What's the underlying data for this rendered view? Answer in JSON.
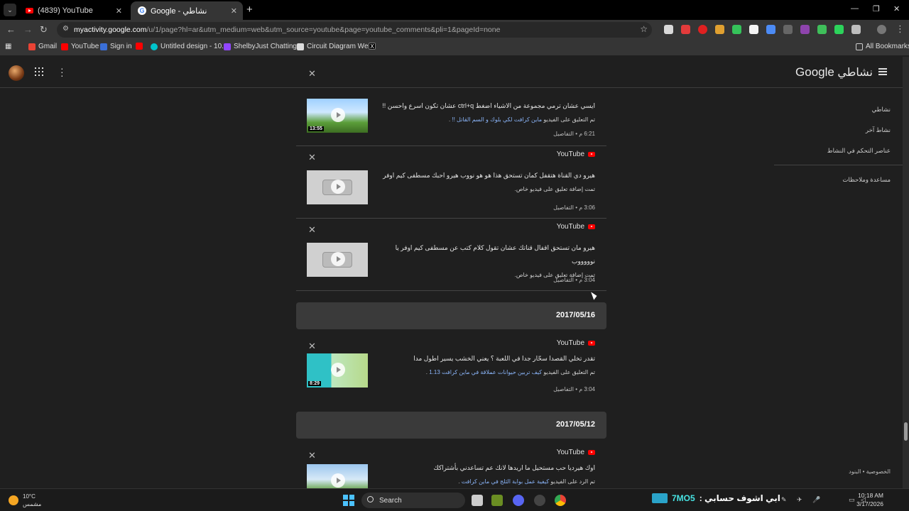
{
  "tabs": [
    {
      "title": "(4839) YouTube",
      "icon": "youtube-icon",
      "active": false
    },
    {
      "title": "Google - نشاطي",
      "icon": "google-icon",
      "active": true
    }
  ],
  "address": {
    "host": "myactivity.google.com",
    "path": "/u/1/page?hl=ar&utm_medium=web&utm_source=youtube&page=youtube_comments&pli=1&pageId=none"
  },
  "bookmarks": [
    "Gmail",
    "YouTube",
    "Sign in",
    "Untitled design - 10...",
    "ShelbyJust Chatting...",
    "Circuit Diagram We...",
    "All Bookmarks"
  ],
  "header": {
    "brand_word": "نشاطي",
    "brand_google": "Google"
  },
  "sidenav": {
    "items": [
      "نشاطي",
      "نشاط آخر",
      "عناصر التحكم في النشاط",
      "مساعدة وملاحظات"
    ]
  },
  "footer": {
    "text": "الخصوصية • البنود"
  },
  "feed": {
    "source_name": "YouTube",
    "items": [
      {
        "comment": "ايسي عشان ترمي مجموعة من الاشياء اضغط ctrl+q عشان تكون اسرع واحسن !!",
        "context_prefix": "تم التعليق على الفيديو",
        "video_title": "ماين كرافت لكي بلوك و السم القاتل !!",
        "time": "6:21 م • التفاصيل",
        "duration": "13:55"
      },
      {
        "comment": "هيرو دي القناة هتقفل كمان تستحق هذا هو هو نووب هيرو احبك مسطفى كيم اوفر",
        "context_prefix": "تمت إضافة تعليق على فيديو خاص.",
        "video_title": "",
        "time": "3:06 م • التفاصيل",
        "duration": ""
      },
      {
        "comment": "هيرو مان تستحق اقفال قناتك عشان تقول كلام كتب عن مسطفى كيم اوفر يا نوووووب",
        "context_prefix": "تمت إضافة تعليق على فيديو خاص.",
        "video_title": "",
        "time": "3:04 م • التفاصيل",
        "duration": ""
      }
    ],
    "date1": "2017/05/16",
    "items2": [
      {
        "comment": "تقدر تخلي القصدا سحّار جدا في اللعبة ؟ يعني الخشب يسير اطول مدا",
        "context_prefix": "تم التعليق على الفيديو",
        "video_title": "كيف تربين حيوانات عملاقة في ماين كرافت 1.13",
        "time": "3:04 م • التفاصيل",
        "duration": "8:29"
      }
    ],
    "date2": "2017/05/12",
    "items3": [
      {
        "comment": "اوك هيرديا حب مستحيل ما اريدها لانك عم تساعدني بأشتراكك",
        "context_prefix": "تم الرد على الفيديو",
        "video_title": "كيفية عمل بوابة الثلج في ماين كرافت",
        "time": "",
        "duration": ""
      }
    ]
  },
  "taskbar": {
    "weather_temp": "10°C",
    "weather_desc": "مشمس",
    "search": "Search",
    "tray_text": "ابي اشوف حسابي :",
    "tray_code": "7MO5",
    "time": "10:18 AM",
    "date": "3/17/2026"
  }
}
